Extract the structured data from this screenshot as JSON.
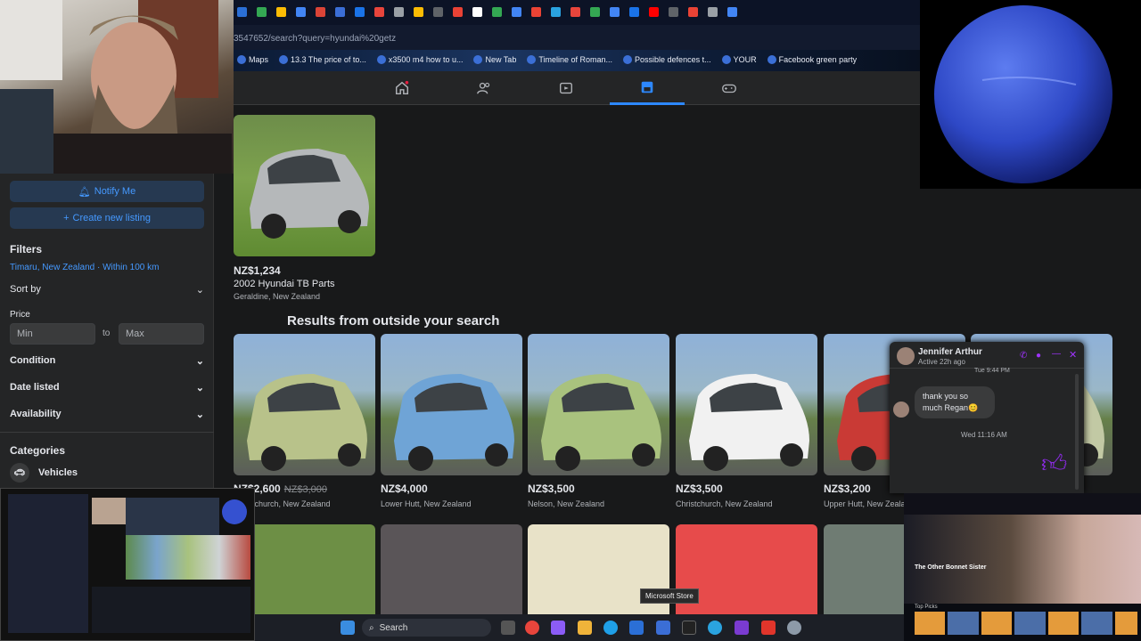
{
  "browser": {
    "address_text": "3547652/search?query=hyundai%20getz",
    "bookmarks": [
      {
        "label": "Maps"
      },
      {
        "label": "13.3 The price of to..."
      },
      {
        "label": "x3500 m4 how to u..."
      },
      {
        "label": "New Tab"
      },
      {
        "label": "Timeline of Roman..."
      },
      {
        "label": "Possible defences t..."
      },
      {
        "label": "YOUR"
      },
      {
        "label": "Facebook green party"
      }
    ]
  },
  "nav": {
    "items": [
      "home-icon",
      "friends-icon",
      "video-icon",
      "marketplace-icon",
      "gaming-icon"
    ],
    "active": "marketplace-icon"
  },
  "sidebar": {
    "notify_label": "Notify Me",
    "create_label": "Create new listing",
    "filters_heading": "Filters",
    "location": "Timaru, New Zealand · Within 100 km",
    "sort_label": "Sort by",
    "price_label": "Price",
    "min_placeholder": "Min",
    "to_label": "to",
    "max_placeholder": "Max",
    "condition_label": "Condition",
    "date_label": "Date listed",
    "availability_label": "Availability",
    "categories_heading": "Categories",
    "vehicles_label": "Vehicles"
  },
  "top_listing": {
    "price": "NZ$1,234",
    "title": "2002 Hyundai TB Parts",
    "location": "Geraldine, New Zealand"
  },
  "outside_heading": "Results from outside your search",
  "listings": [
    {
      "price": "NZ$2,600",
      "old_price": "NZ$3,000",
      "location": "Christchurch, New Zealand",
      "car_color": "#b8c28a"
    },
    {
      "price": "NZ$4,000",
      "old_price": "",
      "location": "Lower Hutt, New Zealand",
      "car_color": "#6fa4d6"
    },
    {
      "price": "NZ$3,500",
      "old_price": "",
      "location": "Nelson, New Zealand",
      "car_color": "#a9c27e"
    },
    {
      "price": "NZ$3,500",
      "old_price": "",
      "location": "Christchurch, New Zealand",
      "car_color": "#f1f1f1"
    },
    {
      "price": "NZ$3,200",
      "old_price": "",
      "location": "Upper Hutt, New Zealand",
      "car_color": "#c93a35"
    },
    {
      "price": "",
      "old_price": "",
      "location": "",
      "car_color": "#c2c9a4"
    }
  ],
  "chat": {
    "name": "Jennifer Arthur",
    "status": "Active 22h ago",
    "partial_time": "Tue 9:44 PM",
    "message": "thank you so much Regan😊",
    "timestamp": "Wed 11:16 AM"
  },
  "taskbar": {
    "search_label": "Search",
    "tooltip": "Microsoft Store"
  },
  "tv": {
    "title": "The Other Bonnet Sister",
    "row_label": "Top Picks"
  }
}
